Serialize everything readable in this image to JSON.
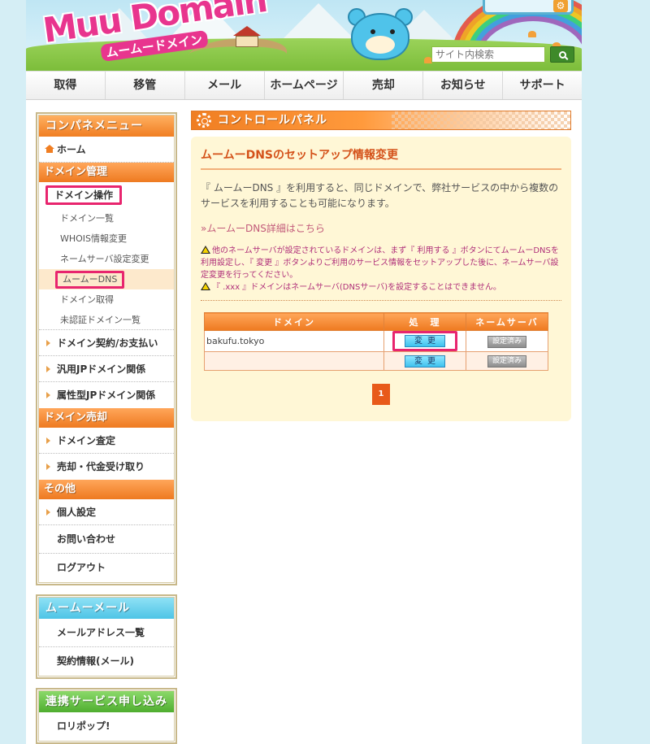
{
  "header": {
    "logo_text": "Muu Domain",
    "logo_sub": "ムームードメイン",
    "search_placeholder": "サイト内検索"
  },
  "nav": {
    "items": [
      "取得",
      "移管",
      "メール",
      "ホームページ",
      "売却",
      "お知らせ",
      "サポート"
    ]
  },
  "sidebar": {
    "menu_title": "コンパネメニュー",
    "home": "ホーム",
    "domain_mgmt_title": "ドメイン管理",
    "domain_ops_head": "ドメイン操作",
    "domain_ops_links": [
      "ドメイン一覧",
      "WHOIS情報変更",
      "ネームサーバ設定変更",
      "ムームーDNS",
      "ドメイン取得",
      "未認証ドメイン一覧"
    ],
    "domain_mgmt_rows": [
      "ドメイン契約/お支払い",
      "汎用JPドメイン関係",
      "属性型JPドメイン関係"
    ],
    "domain_sale_title": "ドメイン売却",
    "domain_sale_rows": [
      "ドメイン査定",
      "売却・代金受け取り"
    ],
    "other_title": "その他",
    "other_rows": [
      "個人設定",
      "お問い合わせ",
      "ログアウト"
    ],
    "mail_title": "ムームーメール",
    "mail_rows": [
      "メールアドレス一覧",
      "契約情報(メール)"
    ],
    "partner_title": "連携サービス申し込み",
    "partner_rows": [
      "ロリポップ!"
    ]
  },
  "main": {
    "header_title": "コントロールパネル",
    "panel_title": "ムームーDNSのセットアップ情報変更",
    "description": "『 ムームーDNS 』を利用すると、同じドメインで、弊社サービスの中から複数のサービスを利用することも可能になります。",
    "more_link": "ムームーDNS詳細はこちら",
    "warning1": "他のネームサーバが設定されているドメインは、まず『 利用する 』ボタンにてムームーDNSを利用設定し、『 変更 』ボタンよりご利用のサービス情報をセットアップした後に、ネームサーバ設定変更を行ってください。",
    "warning2": "『 .xxx 』ドメインはネームサーバ(DNSサーバ)を設定することはできません。",
    "table": {
      "headers": [
        "ドメイン",
        "処　理",
        "ネームサーバ"
      ],
      "rows": [
        {
          "domain": "bakufu.tokyo",
          "action": "変更",
          "ns": "設定済み"
        },
        {
          "domain": "",
          "action": "変更",
          "ns": "設定済み"
        }
      ]
    },
    "pager": {
      "current": "1"
    }
  },
  "colors": {
    "accent": "#f07e22",
    "highlight": "#e8256e"
  }
}
